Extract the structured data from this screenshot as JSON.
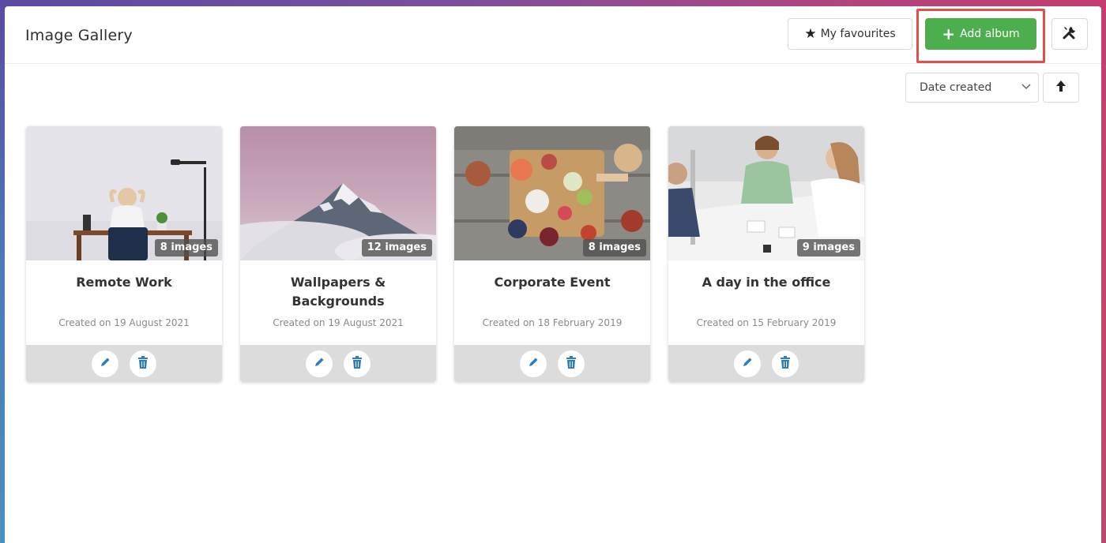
{
  "header": {
    "title": "Image Gallery",
    "favourites_label": "My favourites",
    "add_album_label": "Add album"
  },
  "sort": {
    "selected": "Date created"
  },
  "albums": [
    {
      "name": "Remote Work",
      "count": "8 images",
      "created": "Created on 19 August 2021"
    },
    {
      "name": "Wallpapers & Backgrounds",
      "count": "12 images",
      "created": "Created on 19 August 2021"
    },
    {
      "name": "Corporate Event",
      "count": "8 images",
      "created": "Created on 18 February 2019"
    },
    {
      "name": "A day in the office",
      "count": "9 images",
      "created": "Created on 15 February 2019"
    }
  ],
  "colors": {
    "accent_green": "#4cae4c",
    "highlight_red": "#e0504a",
    "icon_blue": "#2f7cc0"
  },
  "icons": {
    "favourites": "star-icon",
    "add": "plus-icon",
    "settings": "tools-icon",
    "sort_dropdown": "chevron-down-icon",
    "sort_direction": "arrow-up-icon",
    "edit": "pencil-icon",
    "delete": "trash-icon"
  }
}
